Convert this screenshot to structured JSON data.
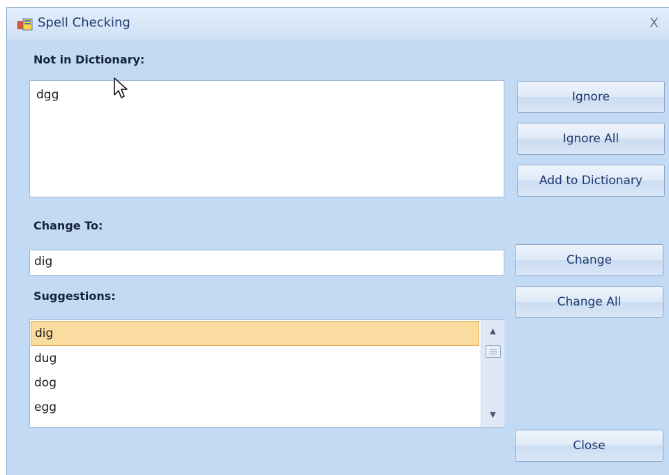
{
  "window": {
    "title": "Spell Checking",
    "close_glyph": "X"
  },
  "not_in_dictionary": {
    "label": "Not in Dictionary:",
    "value": "dgg"
  },
  "change_to": {
    "label": "Change To:",
    "value": "dig"
  },
  "suggestions": {
    "label": "Suggestions:",
    "items": [
      "dig",
      "dug",
      "dog",
      "egg"
    ],
    "selected": "dig"
  },
  "buttons": {
    "ignore": "Ignore",
    "ignore_all": "Ignore All",
    "add_to_dictionary": "Add to Dictionary",
    "change": "Change",
    "change_all": "Change All",
    "close": "Close"
  },
  "icons": {
    "app": "spell-check-app-icon",
    "scroll_up": "triangle-up-icon",
    "scroll_down": "triangle-down-icon",
    "cursor": "mouse-pointer-icon"
  },
  "colors": {
    "background": "#c3daf5",
    "selection": "#fbdca0",
    "title_text": "#1e3a6e"
  }
}
